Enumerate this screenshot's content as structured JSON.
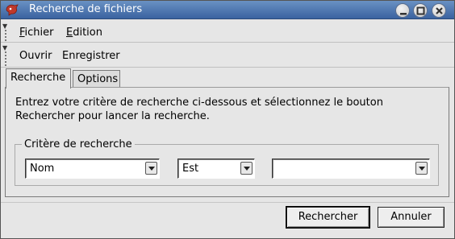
{
  "window": {
    "title": "Recherche de fichiers",
    "controls": [
      "minimize",
      "maximize",
      "close"
    ]
  },
  "menubar": {
    "items": [
      {
        "label": "Fichier",
        "mnemonic": "F"
      },
      {
        "label": "Edition",
        "mnemonic": "E"
      }
    ]
  },
  "toolbar": {
    "items": [
      "Ouvrir",
      "Enregistrer"
    ]
  },
  "tabs": [
    {
      "label": "Recherche",
      "active": true
    },
    {
      "label": "Options",
      "active": false
    }
  ],
  "search_tab": {
    "description_line1": "Entrez votre critère de recherche ci-dessous et sélectionnez le bouton",
    "description_line2": "Rechercher pour lancer la recherche.",
    "criteria_group": {
      "label": "Critère de recherche",
      "field_select": "Nom",
      "operator_select": "Est",
      "value_select": ""
    }
  },
  "buttons": {
    "search": "Rechercher",
    "cancel": "Annuler"
  },
  "colors": {
    "titlebar": "#4a72ad",
    "background": "#e6e6e6"
  },
  "icons": {
    "app": "app-logo-icon",
    "minimize": "minimize-icon",
    "maximize": "maximize-icon",
    "close": "close-icon",
    "dropdown": "chevron-down-icon"
  }
}
